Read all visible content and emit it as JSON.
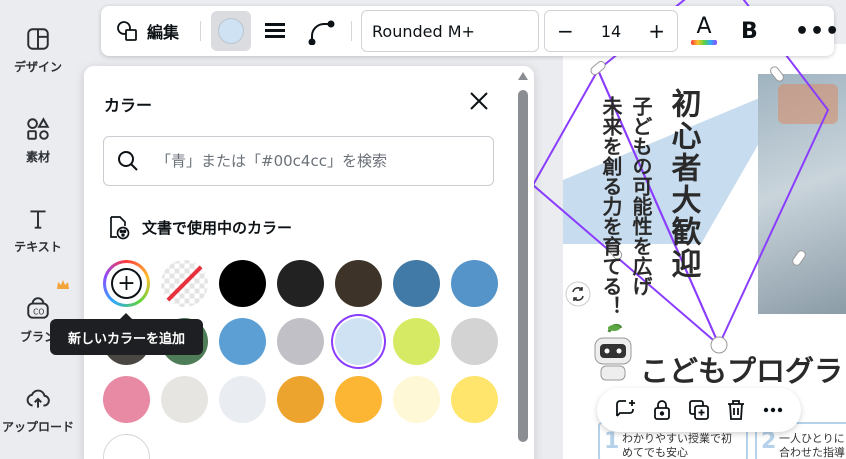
{
  "sidebar": {
    "items": [
      {
        "label": "デザイン",
        "icon": "layout-icon"
      },
      {
        "label": "素材",
        "icon": "elements-icon"
      },
      {
        "label": "テキスト",
        "icon": "text-icon"
      },
      {
        "label": "ブラン",
        "icon": "brand-icon"
      },
      {
        "label": "アップロード",
        "icon": "upload-icon"
      }
    ]
  },
  "toolbar": {
    "edit_label": "編集",
    "font_name": "Rounded M+",
    "font_size": "14",
    "minus": "−",
    "plus": "+",
    "text_color_glyph": "A",
    "bold_glyph": "B",
    "more_glyph": "•••",
    "selected_color": "#cfe2f3"
  },
  "color_panel": {
    "title": "カラー",
    "search_placeholder": "「青」または「#00c4cc」を検索",
    "section_title": "文書で使用中のカラー",
    "tooltip": "新しいカラーを追加",
    "swatches_row1": [
      "#000000",
      "#222222",
      "#3d3328",
      "#417aa6",
      "#5494c8"
    ],
    "swatches_row2": [
      "#4a4641",
      "#4e7d58",
      "#5b9fd5",
      "#c2c0c7",
      "#cfe2f3",
      "#d6ea64",
      "#d3d3d3"
    ],
    "swatches_row3": [
      "#e88aa4",
      "#e6e5e2",
      "#e9ecf0",
      "#eda42e",
      "#fdb534",
      "#fff8d6",
      "#ffe56b"
    ],
    "swatches_row4": [
      "#ffffff"
    ]
  },
  "canvas": {
    "vertical_big": "初心者大歓迎",
    "vertical_mid": "子どもの可能性を広げ",
    "vertical_small": "未来を創る力を育てる！",
    "title": "こどもプログラ",
    "card1_num": "1",
    "card1_text": "わかりやすい授業で初めてでも安心",
    "card2_num": "2",
    "card2_text": "一人ひとりに合わせた指導で成長を"
  },
  "colors": {
    "accent": "#8b3dff"
  }
}
